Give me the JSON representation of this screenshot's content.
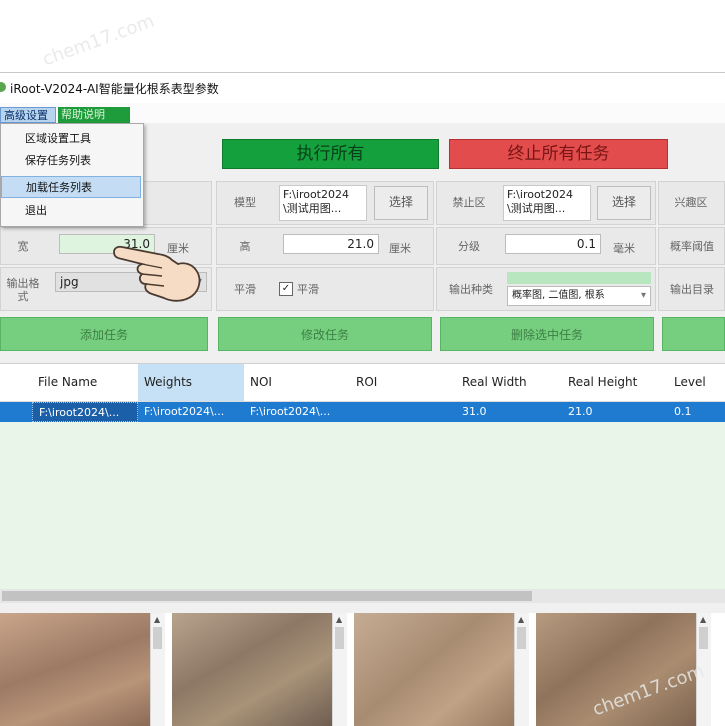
{
  "window": {
    "title": "iRoot-V2024-AI智能量化根系表型参数"
  },
  "menubar": {
    "advanced": "高级设置",
    "help": "帮助说明"
  },
  "advanced_menu": {
    "items": [
      "区域设置工具",
      "保存任务列表",
      "加载任务列表",
      "退出"
    ],
    "highlighted_index": 2
  },
  "toolbar": {
    "execute_all": "执行所有",
    "stop_all": "终止所有任务"
  },
  "form": {
    "model": {
      "label": "模型",
      "path": "F:\\iroot2024\n\\测试用图...",
      "select": "选择"
    },
    "forbidden": {
      "label": "禁止区",
      "path": "F:\\iroot2024\n\\测试用图...",
      "select": "选择"
    },
    "roi": {
      "label": "兴趣区"
    },
    "width": {
      "label": "宽",
      "value": "31.0",
      "unit": "厘米"
    },
    "height": {
      "label": "高",
      "value": "21.0",
      "unit": "厘米"
    },
    "resolution": {
      "label": "分级",
      "value": "0.1",
      "unit": "毫米"
    },
    "prob_threshold": {
      "label": "概率阈值"
    },
    "output_format": {
      "label": "输出格式",
      "value": "jpg"
    },
    "smooth": {
      "label": "平滑",
      "checkbox_label": "平滑",
      "checked": true
    },
    "output_type": {
      "label": "输出种类",
      "value": "概率图, 二值图, 根系"
    },
    "output_dir": {
      "label": "输出目录"
    }
  },
  "task_buttons": {
    "add": "添加任务",
    "modify": "修改任务",
    "delete": "删除选中任务"
  },
  "table": {
    "columns": [
      "File Name",
      "Weights",
      "NOI",
      "ROI",
      "Real Width",
      "Real Height",
      "Level"
    ],
    "rows": [
      {
        "file_name": "F:\\iroot2024\\...",
        "weights": "F:\\iroot2024\\...",
        "noi": "F:\\iroot2024\\...",
        "roi": "",
        "real_width": "31.0",
        "real_height": "21.0",
        "level": "0.1"
      }
    ]
  },
  "watermarks": [
    "chem17.com",
    "chem17.com"
  ],
  "colors": {
    "execute": "#14a03c",
    "stop": "#e24c4c",
    "task_button": "#76cf7f",
    "selected_row": "#1f7bd0"
  }
}
